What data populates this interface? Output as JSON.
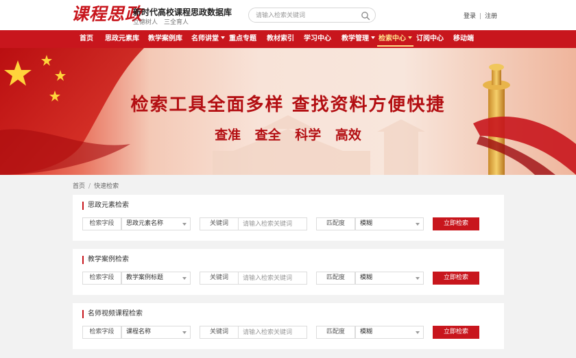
{
  "header": {
    "logo_mark": "课程思政",
    "site_title": "新时代高校课程思政数据库",
    "slogan": "立德树人　三全育人",
    "search_placeholder": "请输入检索关键词",
    "login": "登录",
    "auth_sep": "|",
    "register": "注册"
  },
  "nav": {
    "items": [
      {
        "label": "首页"
      },
      {
        "label": "思政元素库"
      },
      {
        "label": "教学案例库"
      },
      {
        "label": "名师讲堂"
      },
      {
        "label": "重点专题"
      },
      {
        "label": "教材索引"
      },
      {
        "label": "学习中心"
      },
      {
        "label": "教学管理"
      },
      {
        "label": "检索中心"
      },
      {
        "label": "订阅中心"
      },
      {
        "label": "移动端"
      }
    ],
    "active": "检索中心"
  },
  "banner": {
    "title": "检索工具全面多样 查找资料方便快捷",
    "subtitle": "查准 查全 科学 高效"
  },
  "breadcrumb": {
    "home": "首页",
    "sep": "/",
    "current": "快速检索"
  },
  "panels": [
    {
      "title": "思政元素检索",
      "field_label": "检索字段",
      "field_value": "思政元素名称",
      "keyword_label": "关键词",
      "keyword_placeholder": "请输入检索关键词",
      "match_label": "匹配度",
      "match_value": "模糊",
      "button": "立即检索"
    },
    {
      "title": "教学案例检索",
      "field_label": "检索字段",
      "field_value": "教学案例标题",
      "keyword_label": "关键词",
      "keyword_placeholder": "请输入检索关键词",
      "match_label": "匹配度",
      "match_value": "模糊",
      "button": "立即检索"
    },
    {
      "title": "名师视频课程检索",
      "field_label": "检索字段",
      "field_value": "课程名称",
      "keyword_label": "关键词",
      "keyword_placeholder": "请输入检索关键词",
      "match_label": "匹配度",
      "match_value": "模糊",
      "button": "立即检索"
    }
  ],
  "colors": {
    "brand_red": "#c8161d",
    "active_nav": "#ffe08a",
    "page_bg": "#f2f2f2"
  }
}
